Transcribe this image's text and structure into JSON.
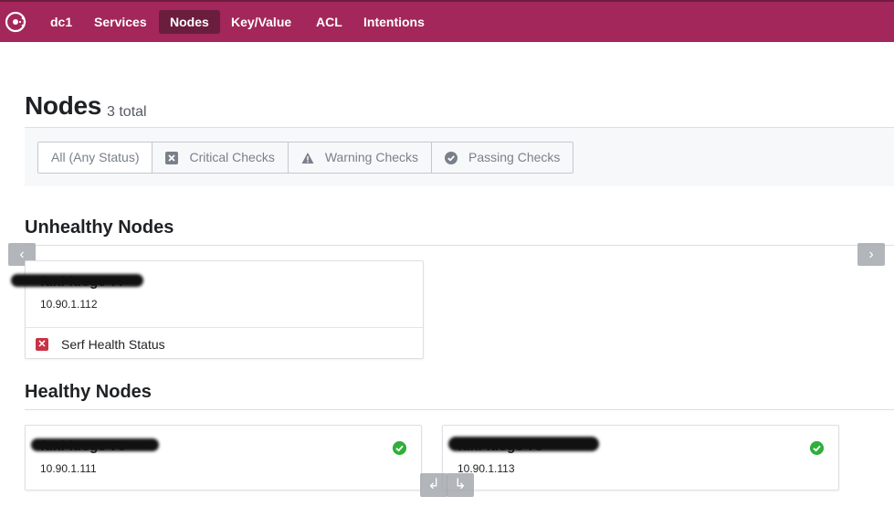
{
  "nav": {
    "items": [
      {
        "label": "dc1"
      },
      {
        "label": "Services"
      },
      {
        "label": "Nodes",
        "active": true
      },
      {
        "label": "Key/Value"
      },
      {
        "label": "ACL"
      },
      {
        "label": "Intentions"
      }
    ],
    "colors": {
      "bar": "#a3275a",
      "active": "#6b1d3d"
    }
  },
  "page": {
    "title": "Nodes",
    "count": "3 total"
  },
  "filters": [
    {
      "label": "All (Any Status)",
      "icon": "",
      "selected": true
    },
    {
      "label": "Critical Checks",
      "icon": "critical-x-icon"
    },
    {
      "label": "Warning Checks",
      "icon": "warning-triangle-icon"
    },
    {
      "label": "Passing Checks",
      "icon": "passing-check-icon"
    }
  ],
  "unhealthy": {
    "title": "Unhealthy Nodes",
    "nodes": [
      {
        "name": "fuxi-luoge-77",
        "address": "10.90.1.112",
        "check": "Serf Health Status"
      }
    ]
  },
  "healthy": {
    "title": "Healthy Nodes",
    "nodes": [
      {
        "name": "fuxi-luoge-76",
        "address": "10.90.1.111"
      },
      {
        "name": "fuxi-luoge-78",
        "address": "10.90.1.113"
      }
    ]
  },
  "pager": {
    "prev": "‹",
    "next": "›",
    "down_left": "↲",
    "down_right": "↳"
  },
  "status_colors": {
    "critical": "#c73445",
    "passing": "#2eb039"
  }
}
